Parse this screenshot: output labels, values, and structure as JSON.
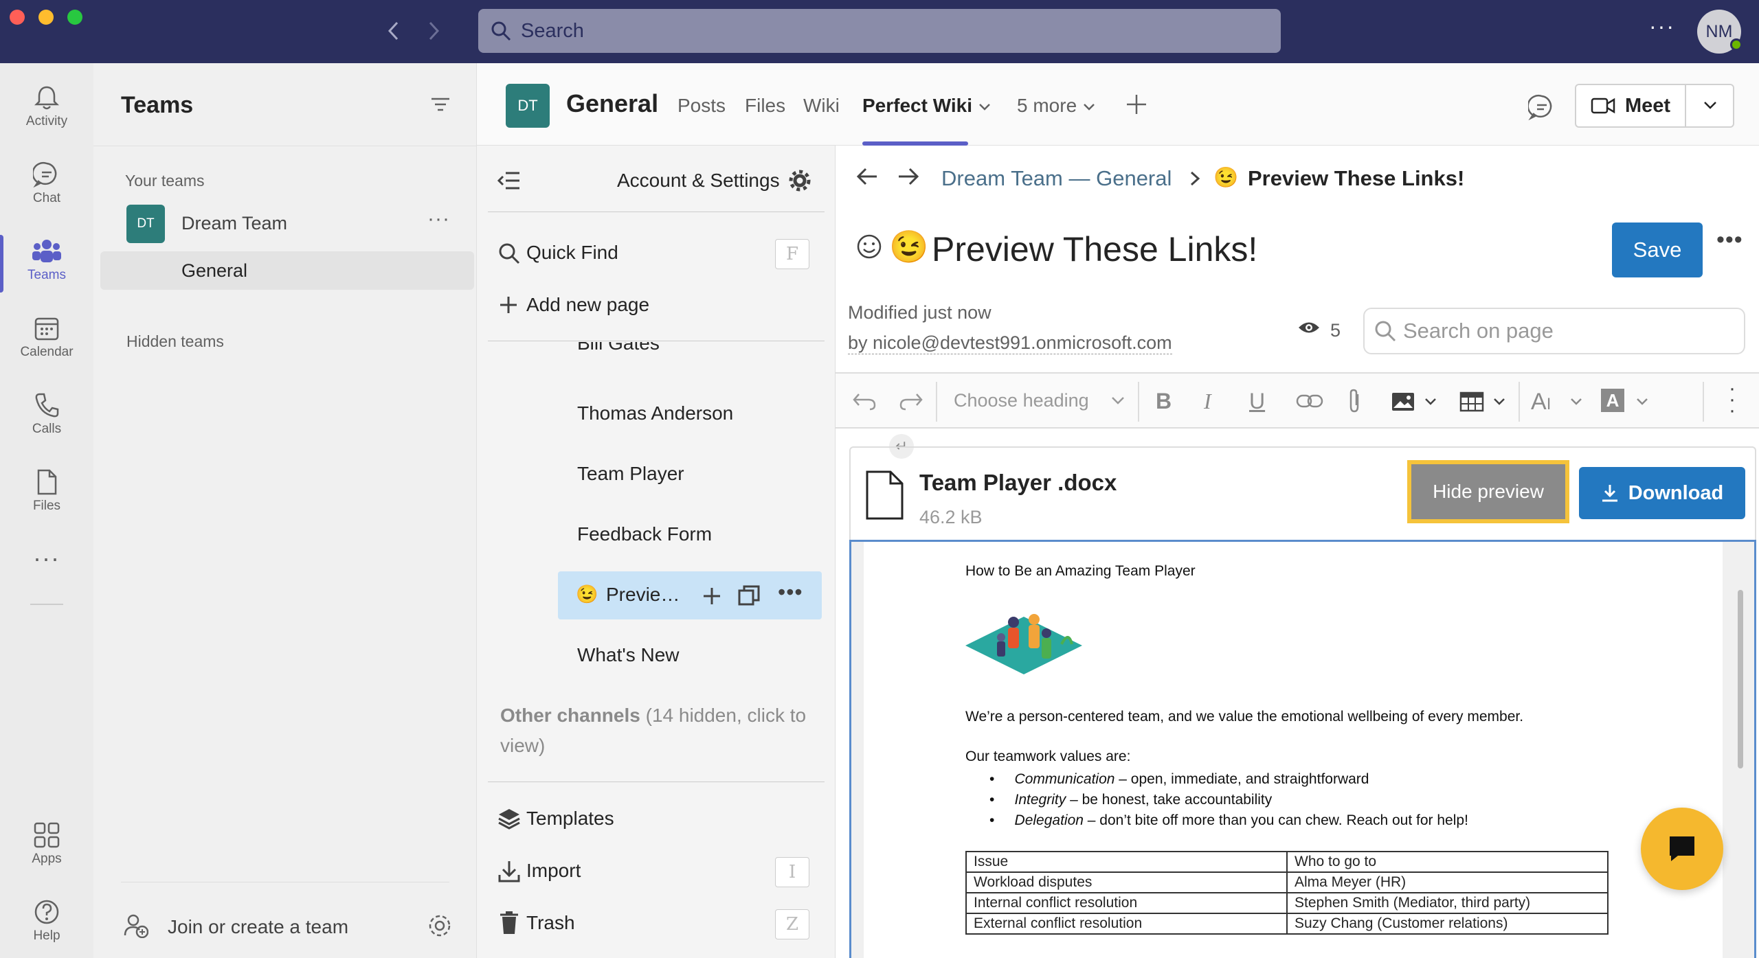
{
  "topbar": {
    "search_placeholder": "Search",
    "avatar_initials": "NM",
    "more": "···"
  },
  "rail": {
    "items": [
      {
        "label": "Activity",
        "icon": "bell-icon"
      },
      {
        "label": "Chat",
        "icon": "chat-icon"
      },
      {
        "label": "Teams",
        "icon": "teams-icon"
      },
      {
        "label": "Calendar",
        "icon": "calendar-icon"
      },
      {
        "label": "Calls",
        "icon": "phone-icon"
      },
      {
        "label": "Files",
        "icon": "file-icon"
      },
      {
        "label": "Apps",
        "icon": "apps-icon"
      },
      {
        "label": "Help",
        "icon": "help-icon"
      }
    ],
    "more": "···"
  },
  "teams_panel": {
    "title": "Teams",
    "your_teams": "Your teams",
    "team_name": "Dream Team",
    "team_initials": "DT",
    "channel": "General",
    "hidden_teams": "Hidden teams",
    "join_create": "Join or create a team"
  },
  "channel_header": {
    "initials": "DT",
    "channel_name": "General",
    "tabs": [
      "Posts",
      "Files",
      "Wiki",
      "Perfect Wiki",
      "5 more"
    ],
    "active_tab": "Perfect Wiki",
    "meet_label": "Meet"
  },
  "wiki_sidebar": {
    "account_settings": "Account & Settings",
    "quick_find": "Quick Find",
    "quick_find_key": "F",
    "add_new_page": "Add new page",
    "pages": [
      "Bill Gates",
      "Thomas Anderson",
      "Team Player",
      "Feedback Form",
      "Previe…",
      "What's New"
    ],
    "selected_emoji": "😉",
    "other_channels_bold": "Other channels",
    "other_channels_rest": " (14 hidden, click to view)",
    "templates": "Templates",
    "import": "Import",
    "import_key": "I",
    "trash": "Trash",
    "trash_key": "Z"
  },
  "page": {
    "breadcrumb_team": "Dream Team — General",
    "breadcrumb_emoji": "😉",
    "breadcrumb_page": "Preview These Links!",
    "title_emoji": "😉",
    "title": "Preview These Links!",
    "save_label": "Save",
    "modified": "Modified just now",
    "modified_by": "by nicole@devtest991.onmicrosoft.com",
    "views": "5",
    "search_placeholder": "Search on page",
    "heading_select": "Choose heading"
  },
  "attachment": {
    "filename": "Team Player .docx",
    "size": "46.2 kB",
    "hide_preview": "Hide preview",
    "download": "Download"
  },
  "document": {
    "heading": "How to Be an Amazing Team Player",
    "intro": "We’re a person-centered team, and we value the emotional wellbeing of every member.",
    "values_heading": "Our teamwork values are:",
    "bullets": [
      {
        "term": "Communication",
        "text": " – open, immediate, and straightforward"
      },
      {
        "term": "Integrity",
        "text": " – be honest, take accountability"
      },
      {
        "term": "Delegation",
        "text": " – don’t bite off more than you can chew. Reach out for help!"
      }
    ],
    "table": {
      "headers": [
        "Issue",
        "Who to go to"
      ],
      "rows": [
        [
          "Workload disputes",
          "Alma Meyer (HR)"
        ],
        [
          "Internal conflict resolution",
          "Stephen Smith (Mediator, third party)"
        ],
        [
          "External conflict resolution",
          "Suzy Chang (Customer relations)"
        ]
      ]
    }
  },
  "colors": {
    "topbar": "#2b2f5e",
    "accent": "#5b5fc7",
    "save_blue": "#2378c0",
    "highlight": "#f5c33b",
    "chat_fab": "#f5b82e"
  }
}
